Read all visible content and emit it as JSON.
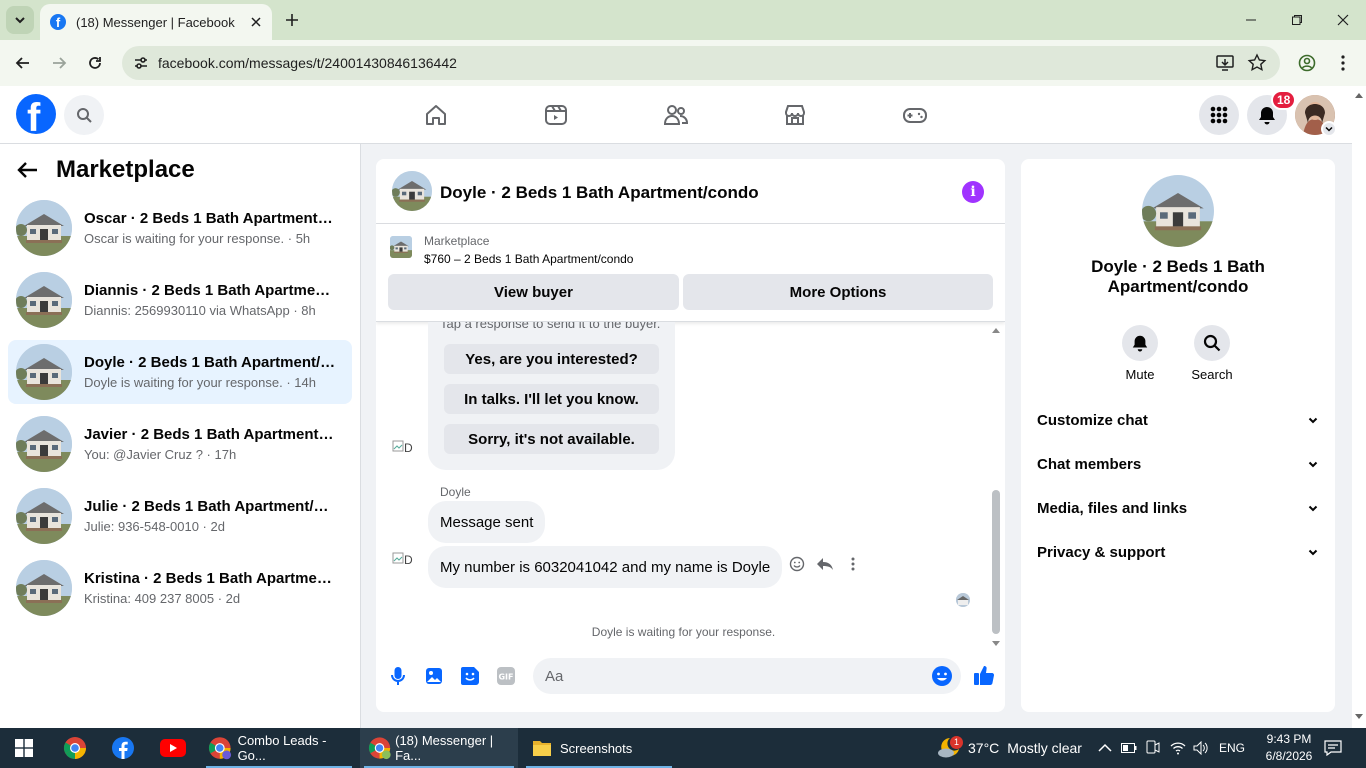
{
  "browser": {
    "tab_title": "(18) Messenger | Facebook",
    "url": "facebook.com/messages/t/24001430846136442"
  },
  "header": {
    "notification_count": "18",
    "brand_color": "#0866ff"
  },
  "sidebar": {
    "title": "Marketplace",
    "conversations": [
      {
        "name": "Oscar · 2 Beds 1 Bath Apartment/c...",
        "preview": "Oscar is waiting for your response. · 5h"
      },
      {
        "name": "Diannis · 2 Beds 1 Bath Apartment...",
        "preview": "Diannis: 2569930110 via WhatsApp · 8h"
      },
      {
        "name": "Doyle · 2 Beds 1 Bath Apartment/c...",
        "preview": "Doyle is waiting for your response. · 14h"
      },
      {
        "name": "Javier · 2 Beds 1 Bath Apartment/c...",
        "preview": "You: @Javier Cruz ? · 17h"
      },
      {
        "name": "Julie · 2 Beds 1 Bath Apartment/co...",
        "preview": "Julie: 936-548-0010 · 2d"
      },
      {
        "name": "Kristina · 2 Beds 1 Bath Apartment...",
        "preview": "Kristina: 409 237 8005 · 2d"
      }
    ]
  },
  "chat": {
    "title": "Doyle · 2 Beds 1 Bath Apartment/condo",
    "listing_label": "Marketplace",
    "listing_price": "$760 – 2 Beds 1 Bath Apartment/condo",
    "view_buyer": "View buyer",
    "more_options": "More Options",
    "quick_hint": "Tap a response to send it to the buyer.",
    "quick_replies": [
      "Yes, are you interested?",
      "In talks. I'll let you know.",
      "Sorry, it's not available."
    ],
    "avatar_alt": "D",
    "sender": "Doyle",
    "message1": "Message sent",
    "message2": "My number is 6032041042 and my name is Doyle",
    "status": "Doyle is waiting for your response.",
    "placeholder": "Aa"
  },
  "right_panel": {
    "name_line1": "Doyle · 2 Beds 1 Bath",
    "name_line2": "Apartment/condo",
    "mute": "Mute",
    "search": "Search",
    "sections": [
      "Customize chat",
      "Chat members",
      "Media, files and links",
      "Privacy & support"
    ]
  },
  "taskbar": {
    "combo_leads": "Combo Leads - Go...",
    "messenger": "(18) Messenger | Fa...",
    "screenshots": "Screenshots",
    "weather_temp": "37°C",
    "weather_text": "Mostly clear",
    "weather_badge": "1",
    "lang": "ENG",
    "time": "9:43 PM",
    "date": "6/8/2026"
  }
}
